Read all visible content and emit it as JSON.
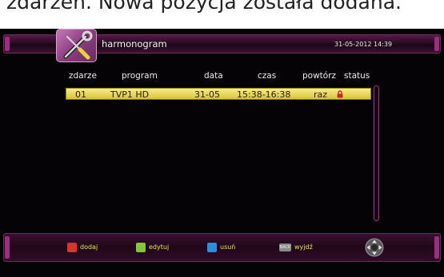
{
  "caption": "zdarzeń. Nowa pozycja została dodana.",
  "header": {
    "title": "harmonogram",
    "datetime": "31-05-2012 14:39",
    "icon": "tools-icon"
  },
  "columns": [
    "zdarze",
    "program",
    "data",
    "czas",
    "powtórz",
    "status"
  ],
  "rows": [
    {
      "event": "01",
      "program": "TVP1 HD",
      "date": "31-05",
      "time": "15:38-16:38",
      "repeat": "raz",
      "status_icon": "lock-icon"
    }
  ],
  "footer": {
    "red_label": "dodaj",
    "green_label": "edytuj",
    "blue_label": "usuń",
    "back_key": "BACK",
    "back_label": "wyjdź"
  },
  "colors": {
    "red": "#d9342b",
    "green": "#86c440",
    "blue": "#2a8fe0",
    "highlight": "#efe06a",
    "accent": "#9b2f7f"
  }
}
